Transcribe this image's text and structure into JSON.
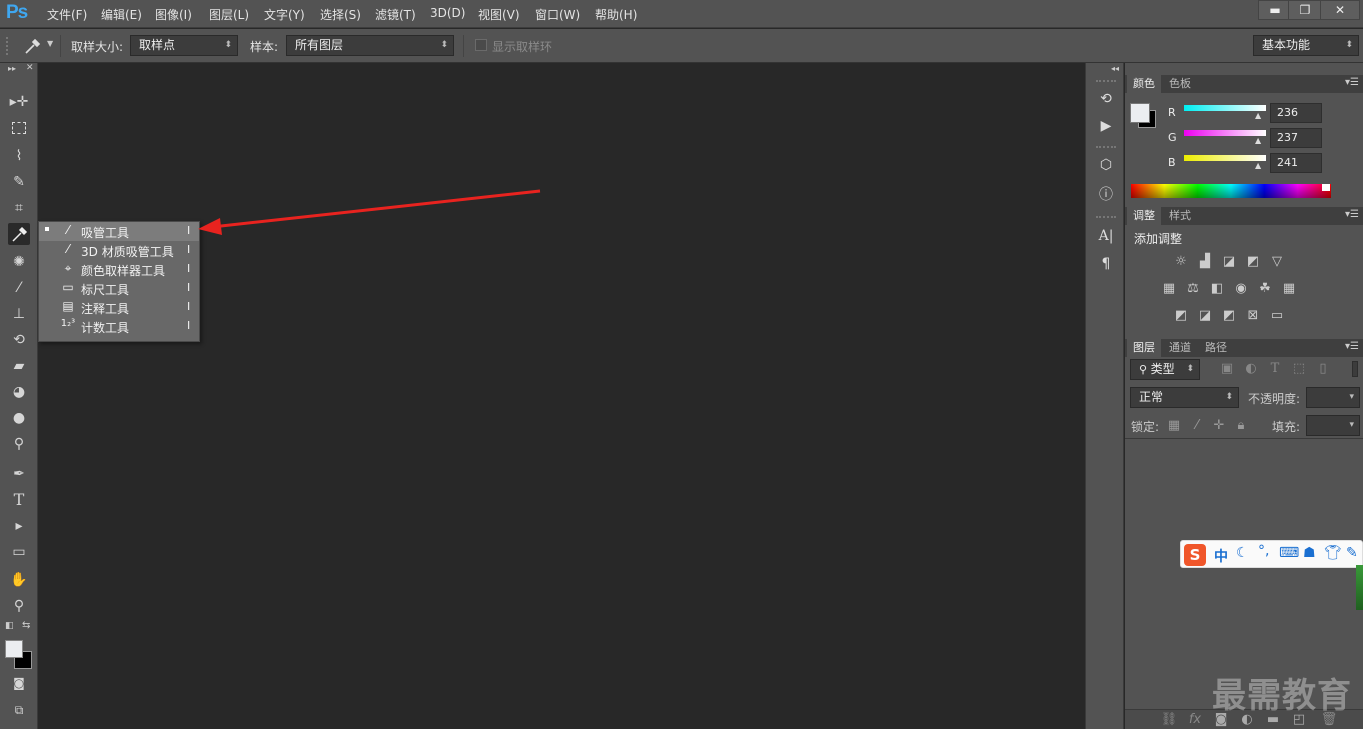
{
  "app": {
    "logo": "Ps"
  },
  "menubar": {
    "items": [
      "文件(F)",
      "编辑(E)",
      "图像(I)",
      "图层(L)",
      "文字(Y)",
      "选择(S)",
      "滤镜(T)",
      "3D(D)",
      "视图(V)",
      "窗口(W)",
      "帮助(H)"
    ]
  },
  "window_controls": {
    "minimize": "▬",
    "restore": "❐",
    "close": "✕"
  },
  "options": {
    "sample_size_label": "取样大小:",
    "sample_size_value": "取样点",
    "sample_label": "样本:",
    "sample_value": "所有图层",
    "show_ring_label": "显示取样环",
    "workspace_value": "基本功能"
  },
  "flyout": {
    "items": [
      {
        "label": "吸管工具",
        "key": "I",
        "icon": "eyedropper-icon",
        "selected": true
      },
      {
        "label": "3D 材质吸管工具",
        "key": "I",
        "icon": "3d-eyedropper-icon"
      },
      {
        "label": "颜色取样器工具",
        "key": "I",
        "icon": "color-sampler-icon"
      },
      {
        "label": "标尺工具",
        "key": "I",
        "icon": "ruler-icon"
      },
      {
        "label": "注释工具",
        "key": "I",
        "icon": "note-icon"
      },
      {
        "label": "计数工具",
        "key": "I",
        "icon": "count-icon"
      }
    ]
  },
  "color_panel": {
    "tabs": [
      "颜色",
      "色板"
    ],
    "r_label": "R",
    "g_label": "G",
    "b_label": "B",
    "r": "236",
    "g": "237",
    "b": "241",
    "foreground": "#eceef1",
    "background": "#000000"
  },
  "adjust_panel": {
    "tabs": [
      "调整",
      "样式"
    ],
    "title": "添加调整"
  },
  "layers_panel": {
    "tabs": [
      "图层",
      "通道",
      "路径"
    ],
    "filter_value": "类型",
    "blend_value": "正常",
    "opacity_label": "不透明度:",
    "lock_label": "锁定:",
    "fill_label": "填充:"
  },
  "ime": {
    "lang": "中"
  },
  "watermark": "最需教育",
  "colors": {
    "arrow": "#e8231f",
    "ps_blue": "#3fa7f0"
  }
}
